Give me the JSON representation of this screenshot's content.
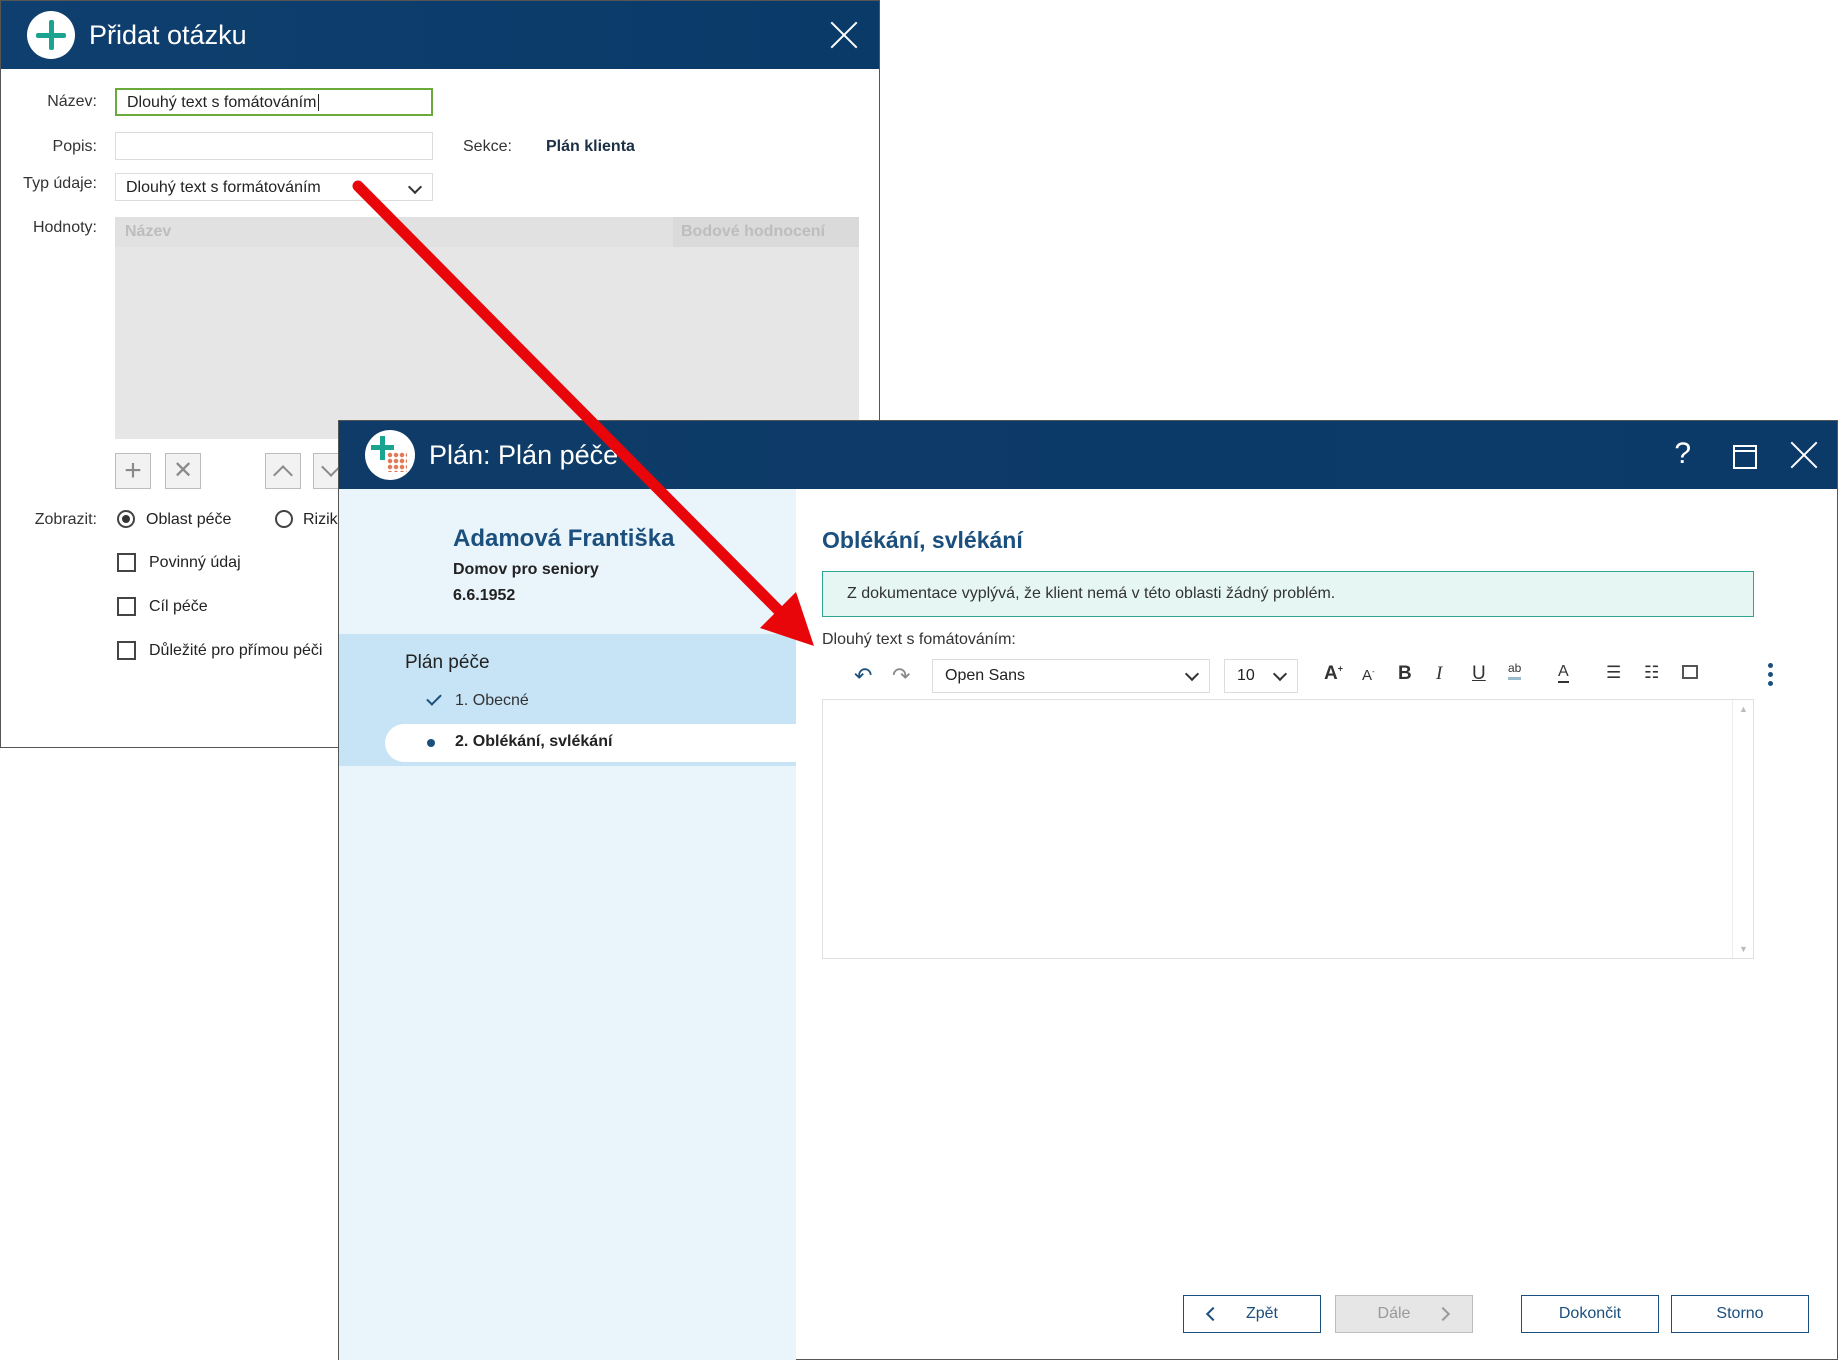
{
  "dialog1": {
    "title": "Přidat otázku",
    "labels": {
      "nazev": "Název:",
      "popis": "Popis:",
      "typ": "Typ údaje:",
      "hodnoty": "Hodnoty:",
      "zobrazit": "Zobrazit:",
      "sekce": "Sekce:"
    },
    "nazev_value": "Dlouhý text s fomátováním",
    "popis_value": "",
    "typ_value": "Dlouhý text s formátováním",
    "sekce_value": "Plán klienta",
    "grid_headers": [
      "Název",
      "Bodové hodnocení"
    ],
    "radios": [
      {
        "label": "Oblast péče",
        "checked": true
      },
      {
        "label": "Rizik",
        "checked": false
      }
    ],
    "checkboxes": [
      {
        "label": "Povinný údaj",
        "checked": false
      },
      {
        "label": "Cíl péče",
        "checked": false
      },
      {
        "label": "Důležité pro přímou péči",
        "checked": false
      }
    ]
  },
  "dialog2": {
    "title": "Plán: Plán péče",
    "help_label": "?",
    "patient": {
      "name": "Adamová Františka",
      "org": "Domov pro seniory",
      "dob": "6.6.1952"
    },
    "nav": {
      "title": "Plán péče",
      "items": [
        {
          "label": "1. Obecné",
          "state": "done"
        },
        {
          "label": "2. Oblékání, svlékání",
          "state": "current"
        }
      ]
    },
    "section_title": "Oblékání, svlékání",
    "info_text": "Z dokumentace vyplývá, že klient nemá v této oblasti žádný problém.",
    "editor_label": "Dlouhý text s fomátováním:",
    "editor_content": "",
    "toolbar": {
      "font": "Open Sans",
      "size": "10",
      "bold": "B",
      "italic": "I",
      "underline": "U",
      "grow": "A",
      "shrink": "A",
      "highlight": "ab",
      "color": "A"
    },
    "buttons": {
      "back": "Zpět",
      "next": "Dále",
      "finish": "Dokončit",
      "cancel": "Storno"
    }
  },
  "colors": {
    "titlebar": "#0e3b68",
    "accent": "#1b4f7d",
    "teal": "#1aa38f",
    "arrow": "#e8060a"
  },
  "icons": [
    "add-circle-icon",
    "close-icon",
    "app-logo-icon",
    "help-icon",
    "maximize-icon",
    "undo-icon",
    "redo-icon",
    "bullet-list-icon",
    "numbered-list-icon",
    "image-icon",
    "more-vertical-icon",
    "check-icon"
  ]
}
